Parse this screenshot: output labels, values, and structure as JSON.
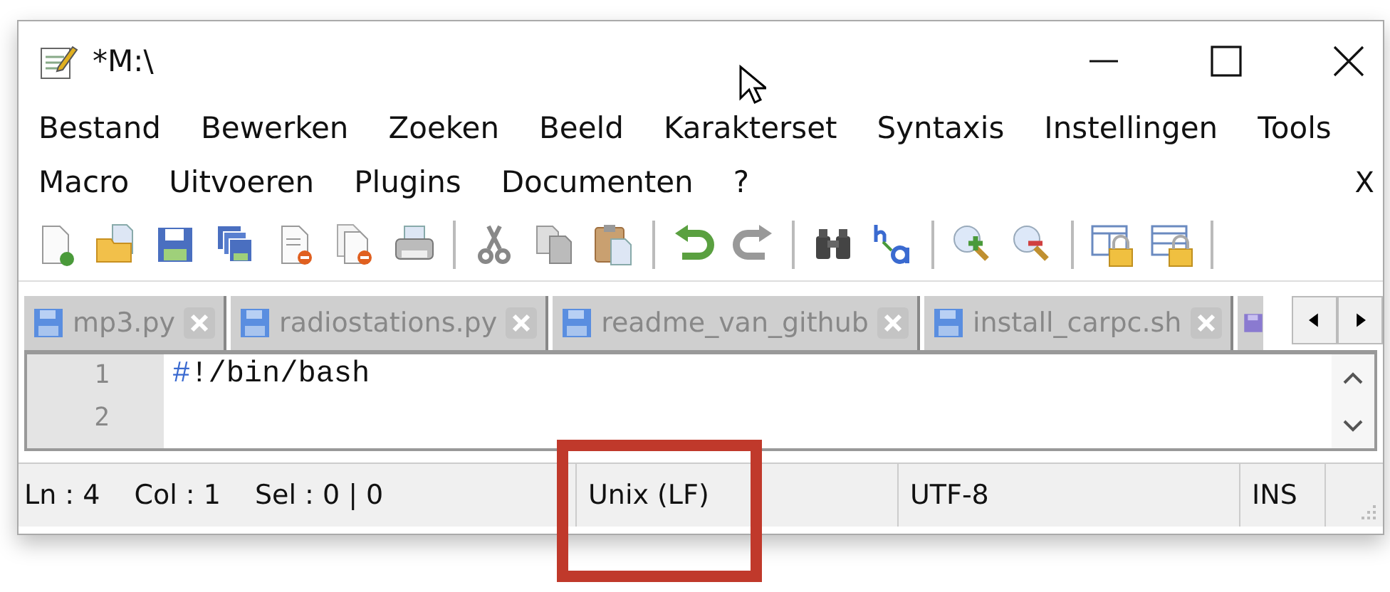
{
  "window": {
    "title": "*M:\\"
  },
  "menu_rows": [
    [
      "Bestand",
      "Bewerken",
      "Zoeken",
      "Beeld",
      "Karakterset",
      "Syntaxis",
      "Instellingen",
      "Tools"
    ],
    [
      "Macro",
      "Uitvoeren",
      "Plugins",
      "Documenten",
      "?"
    ]
  ],
  "menu_close": "X",
  "tabs": [
    {
      "label": "mp3.py",
      "selected": false
    },
    {
      "label": "radiostations.py",
      "selected": false
    },
    {
      "label": "readme_van_github",
      "selected": false
    },
    {
      "label": "install_carpc.sh",
      "selected": false
    }
  ],
  "editor": {
    "lines": [
      {
        "number": "1",
        "text": "#!/bin/bash"
      },
      {
        "number": "2"
      }
    ]
  },
  "status_bar": {
    "position": [
      "Ln : 4",
      "Col : 1",
      "Sel : 0 | 0"
    ],
    "eol": "Unix (LF)",
    "encoding": "UTF-8",
    "mode": "INS"
  },
  "annotation": {
    "kind": "highlight-rectangle"
  }
}
